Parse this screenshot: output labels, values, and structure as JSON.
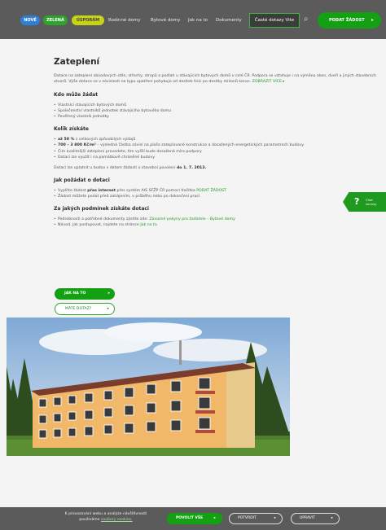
{
  "topbar": {
    "pills": [
      "NOVÉ",
      "ZELENÁ",
      "ÚSPORÁM"
    ],
    "nav": [
      "Rodinné domy",
      "Bytové domy",
      "Jak na to",
      "Dokumenty"
    ],
    "faq_label": "Časté dotazy",
    "faq_suffix": "Vite",
    "cta_label": "PODAT ŽÁDOST"
  },
  "main": {
    "title": "Zateplení",
    "intro": "Dotace na zateplení obvodových stěn, střechy, stropů a podlah u stávajících bytových domů v celé ČR. Podpora se vztahuje i na výměnu oken, dveří a jiných stavebních otvorů. Výše dotace se v závislosti na typu opatření pohybuje od desítek tisíc po desítky milionů korun.",
    "intro_more": "ZOBRAZIT VÍCE ▸",
    "who": {
      "title": "Kdo může žádat",
      "items": [
        "Vlastníci stávajících bytových domů",
        "Společenství vlastníků jednotek stávajícího bytového domu",
        "Pověřený vlastník jednotky"
      ]
    },
    "how_much": {
      "title": "Kolik získáte",
      "items": [
        {
          "b": "až 50 %",
          "t": " z celkových způsobilých výdajů"
        },
        {
          "b": "700 – 3 800 Kč/m²",
          "t": " – výsledná částka závisí na ploše zateplované konstrukce a dosažených energetických parametrech budovy."
        },
        {
          "b": "",
          "t": "Čím kvalitnější zateplení provedete, tím vyšší bude dosažená míra podpory"
        },
        {
          "b": "",
          "t": "Dotaci lze využít i na památkově chráněné budovy"
        }
      ],
      "note_prefix": "Dotaci lze uplatnit u budov s datem žádosti o stavební povolení",
      "note_bold": "do 1. 7. 2013."
    },
    "how_apply": {
      "title": "Jak požádat o dotaci",
      "item1_prefix": "Vyplňte žádost",
      "item1_bold": "přes internet",
      "item1_mid": "přes systém AIS SFŽP ČR pomocí tlačítka",
      "item1_link": "PODAT ŽÁDOST",
      "item2": "Žádost můžete podat před zahájením, v průběhu nebo po dokončení prací"
    },
    "conditions": {
      "title": "Za jakých podmínek získáte dotaci",
      "item1_prefix": "Podrobnosti a potřebné dokumenty zjistíte zde:",
      "item1_link": "Závazné pokyny pro žadatele – Bytové domy",
      "item2_prefix": "Návod, jak postupovat, najdete na stránce",
      "item2_link": "Jak na to"
    },
    "btn_primary": "JAK NA TO",
    "btn_outline": "MÁTE DOTAZ?"
  },
  "side_help": {
    "q": "?",
    "text": "Chat servisy"
  },
  "cookie": {
    "text_prefix": "K provozování webu a analýze návštěvnosti používáme",
    "link": "soubory cookies.",
    "btn_accept": "POVOLIT VŠE",
    "btn_confirm": "POTVRDIT",
    "btn_settings": "UPRAVIT"
  },
  "icons": {
    "search": "search-icon",
    "arrow": "chevron-right-icon"
  },
  "colors": {
    "green": "#13a013",
    "dark_bar": "#5b5b5b",
    "yellow_pill": "#c8d317",
    "blue_pill": "#2f7fd6"
  }
}
